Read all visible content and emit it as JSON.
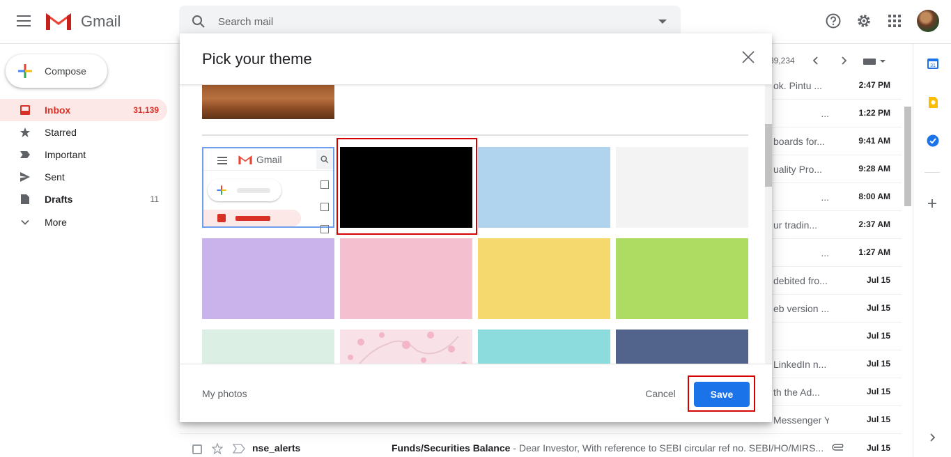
{
  "app": {
    "name": "Gmail"
  },
  "search": {
    "placeholder": "Search mail"
  },
  "compose": {
    "label": "Compose"
  },
  "nav": [
    {
      "label": "Inbox",
      "count": "31,139",
      "icon": "inbox-icon"
    },
    {
      "label": "Starred",
      "count": "",
      "icon": "star-icon"
    },
    {
      "label": "Important",
      "count": "",
      "icon": "important-icon"
    },
    {
      "label": "Sent",
      "count": "",
      "icon": "send-icon"
    },
    {
      "label": "Drafts",
      "count": "11",
      "icon": "draft-icon"
    },
    {
      "label": "More",
      "count": "",
      "icon": "chevron-down-icon"
    }
  ],
  "toolbar": {
    "range_partial": "89,234"
  },
  "inbox_rows": [
    {
      "snippet": "ok. Pintu ...",
      "date": "2:47 PM"
    },
    {
      "snippet": "...",
      "date": "1:22 PM"
    },
    {
      "snippet": "boards for...",
      "date": "9:41 AM"
    },
    {
      "snippet": "uality Pro...",
      "date": "9:28 AM"
    },
    {
      "snippet": "...",
      "date": "8:00 AM"
    },
    {
      "snippet": "ur tradin...",
      "date": "2:37 AM"
    },
    {
      "snippet": "...",
      "date": "1:27 AM"
    },
    {
      "snippet": "debited fro...",
      "date": "Jul 15"
    },
    {
      "snippet": "eb version ...",
      "date": "Jul 15"
    },
    {
      "snippet": "",
      "date": "Jul 15"
    },
    {
      "snippet": "LinkedIn n...",
      "date": "Jul 15"
    },
    {
      "snippet": "th the Ad...",
      "date": "Jul 15"
    },
    {
      "snippet": "Messenger Y...",
      "date": "Jul 15"
    }
  ],
  "last_row": {
    "sender": "nse_alerts",
    "subject": "Funds/Securities Balance",
    "snippet": " - Dear Investor, With reference to SEBI circular ref no. SEBI/HO/MIRS...",
    "date": "Jul 15"
  },
  "modal": {
    "title": "Pick your theme",
    "my_photos": "My photos",
    "cancel": "Cancel",
    "save": "Save",
    "preview_label": "Gmail"
  },
  "themes": {
    "colors": [
      "#000000",
      "#b0d4ee",
      "#f3f3f3",
      "#c9b3ea",
      "#f4bfcf",
      "#f5d96e",
      "#addc63",
      "#dbefe4",
      "#f8e1e7",
      "#8cdbdd",
      "#52648c"
    ]
  }
}
